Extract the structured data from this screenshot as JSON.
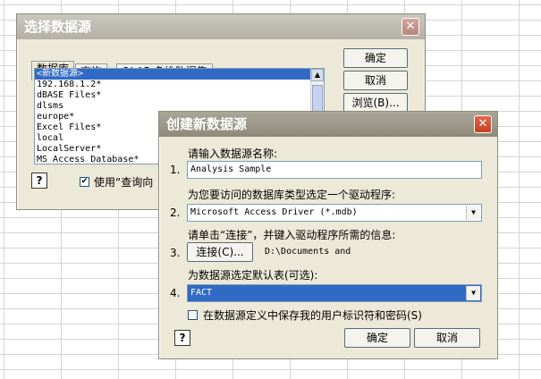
{
  "bg_dialog": {
    "title": "选择数据源",
    "close_glyph": "✕",
    "tabs": [
      {
        "label": "数据库"
      },
      {
        "label": "查询"
      },
      {
        "label": "OLAP 多维数据集"
      }
    ],
    "sources": [
      "<新数据源>",
      "192.168.1.2*",
      "dBASE Files*",
      "dlsms",
      "europe*",
      "Excel Files*",
      "local",
      "LocalServer*",
      "MS Access Database*"
    ],
    "ok_label": "确定",
    "cancel_label": "取消",
    "browse_label": "浏览(B)...",
    "use_query_wizard_label": "使用“查询向",
    "use_query_wizard_checked": true
  },
  "fg_dialog": {
    "title": "创建新数据源",
    "close_glyph": "✕",
    "step1_prompt": "请输入数据源名称:",
    "step1_num": "1.",
    "name_value": "Analysis Sample",
    "step2_prompt": "为您要访问的数据库类型选定一个驱动程序:",
    "step2_num": "2.",
    "driver_value": "Microsoft Access Driver (*.mdb)",
    "step3_prompt": "请单击“连接”，并键入驱动程序所需的信息:",
    "step3_num": "3.",
    "connect_label": "连接(C)...",
    "connect_path": "D:\\Documents and",
    "step4_prompt": "为数据源选定默认表(可选):",
    "step4_num": "4.",
    "table_value": "FACT",
    "save_credentials_label": "在数据源定义中保存我的用户标识符和密码(S)",
    "save_credentials_checked": false,
    "ok_label": "确定",
    "cancel_label": "取消"
  },
  "glyphs": {
    "help": "?",
    "check": "✔",
    "dropdown": "▼",
    "scroll_up": "▲"
  }
}
